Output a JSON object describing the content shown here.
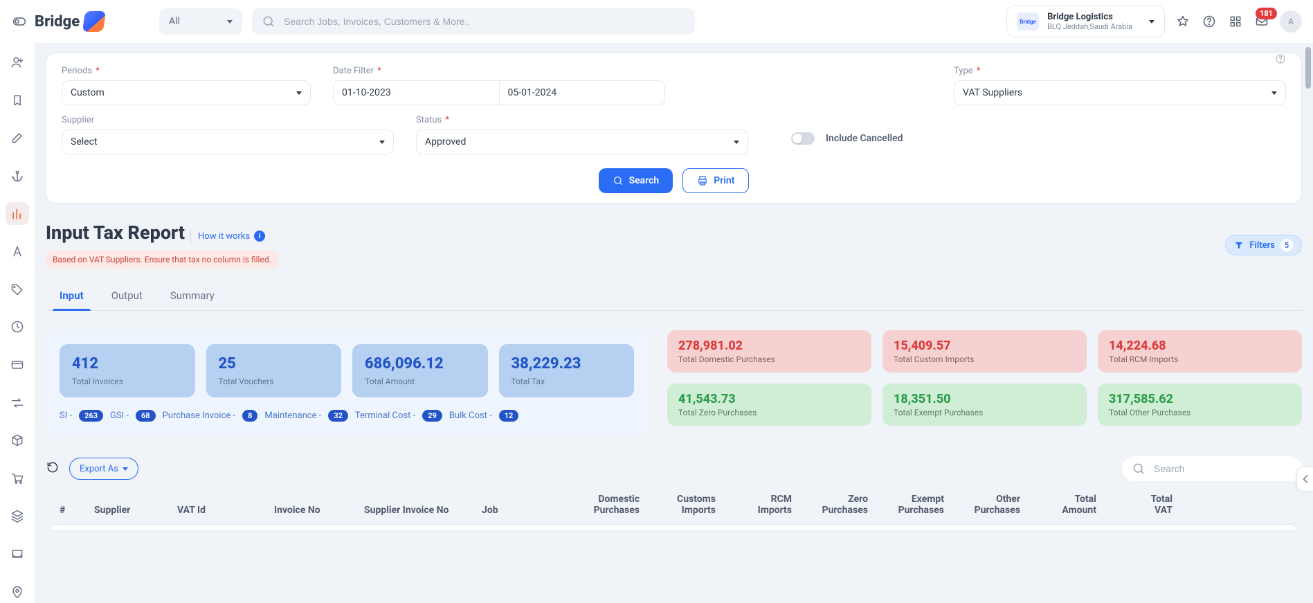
{
  "header": {
    "scope": "All",
    "search_placeholder": "Search Jobs, Invoices, Customers & More..",
    "company_name": "Bridge Logistics",
    "company_sub": "BLQ Jeddah,Saudi Arabia",
    "mail_badge": "181",
    "avatar": "A",
    "logo_text": "Bridge"
  },
  "filters": {
    "periods_label": "Periods",
    "periods_value": "Custom",
    "date_label": "Date Filter",
    "date_from": "01-10-2023",
    "date_to": "05-01-2024",
    "type_label": "Type",
    "type_value": "VAT Suppliers",
    "supplier_label": "Supplier",
    "supplier_value": "Select",
    "status_label": "Status",
    "status_value": "Approved",
    "cancelled_label": "Include Cancelled",
    "search_btn": "Search",
    "print_btn": "Print"
  },
  "page": {
    "title": "Input Tax Report",
    "how_it_works": "How it works",
    "filters_label": "Filters",
    "filters_count": "5",
    "warn": "Based on VAT Suppliers. Ensure that tax no column is filled."
  },
  "tabs": {
    "input": "Input",
    "output": "Output",
    "summary": "Summary"
  },
  "stats": {
    "cards": [
      {
        "val": "412",
        "lbl": "Total Invoices"
      },
      {
        "val": "25",
        "lbl": "Total Vouchers"
      },
      {
        "val": "686,096.12",
        "lbl": "Total Amount"
      },
      {
        "val": "38,229.23",
        "lbl": "Total Tax"
      }
    ],
    "counters": {
      "si_label": "SI -",
      "si": "263",
      "gsi_label": "GSI -",
      "gsi": "68",
      "pi_label": "Purchase Invoice -",
      "pi": "8",
      "mt_label": "Maintenance -",
      "mt": "32",
      "tc_label": "Terminal Cost -",
      "tc": "29",
      "bc_label": "Bulk Cost -",
      "bc": "12"
    },
    "tiles_top": [
      {
        "val": "278,981.02",
        "lbl": "Total Domestic Purchases"
      },
      {
        "val": "15,409.57",
        "lbl": "Total Custom Imports"
      },
      {
        "val": "14,224.68",
        "lbl": "Total RCM Imports"
      }
    ],
    "tiles_bottom": [
      {
        "val": "41,543.73",
        "lbl": "Total Zero Purchases"
      },
      {
        "val": "18,351.50",
        "lbl": "Total Exempt Purchases"
      },
      {
        "val": "317,585.62",
        "lbl": "Total Other Purchases"
      }
    ]
  },
  "toolbar": {
    "export": "Export As",
    "search_placeholder": "Search"
  },
  "columns": {
    "hash": "#",
    "supplier": "Supplier",
    "vat": "VAT Id",
    "inv": "Invoice No",
    "sinv": "Supplier Invoice No",
    "job": "Job",
    "dom1": "Domestic",
    "dom2": "Purchases",
    "cus1": "Customs",
    "cus2": "Imports",
    "rcm1": "RCM",
    "rcm2": "Imports",
    "zero1": "Zero",
    "zero2": "Purchases",
    "ex1": "Exempt",
    "ex2": "Purchases",
    "oth1": "Other",
    "oth2": "Purchases",
    "tot1": "Total",
    "tot2": "Amount",
    "vat1": "Total",
    "vat2": "VAT"
  }
}
